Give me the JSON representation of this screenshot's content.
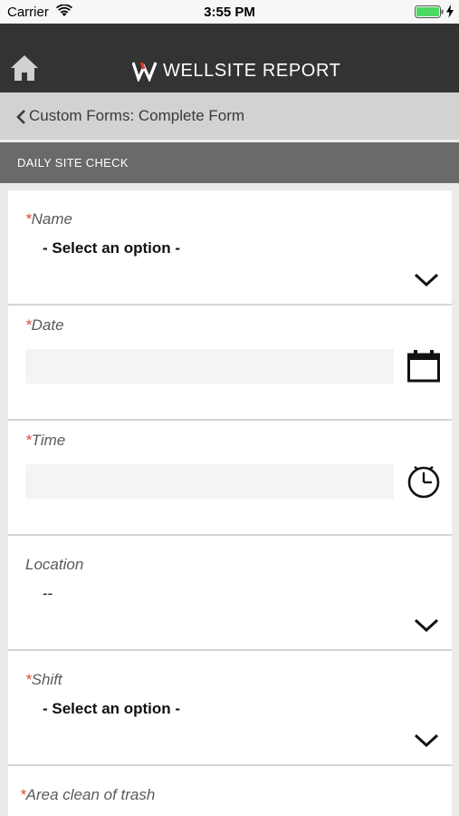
{
  "status_bar": {
    "carrier": "Carrier",
    "time": "3:55 PM"
  },
  "header": {
    "title": "WELLSITE REPORT"
  },
  "breadcrumb": {
    "label": "Custom Forms: Complete Form"
  },
  "section": {
    "title": "DAILY SITE CHECK"
  },
  "colors": {
    "header_bg": "#333333",
    "required_marker": "#e0473a",
    "section_bg": "#6a6a6a",
    "breadcrumb_bg": "#d2d2d2"
  },
  "form": {
    "fields": [
      {
        "label": "Name",
        "required": "*",
        "type": "select",
        "value": "- Select an option -"
      },
      {
        "label": "Date",
        "required": "*",
        "type": "date",
        "value": "",
        "icon": "calendar-icon"
      },
      {
        "label": "Time",
        "required": "*",
        "type": "time",
        "value": "",
        "icon": "clock-icon"
      },
      {
        "label": "Location",
        "required": "",
        "type": "select",
        "value": "--"
      },
      {
        "label": "Shift",
        "required": "*",
        "type": "select",
        "value": "- Select an option -"
      },
      {
        "label": "Area clean of trash",
        "required": "*",
        "type": "select",
        "value": ""
      }
    ]
  }
}
